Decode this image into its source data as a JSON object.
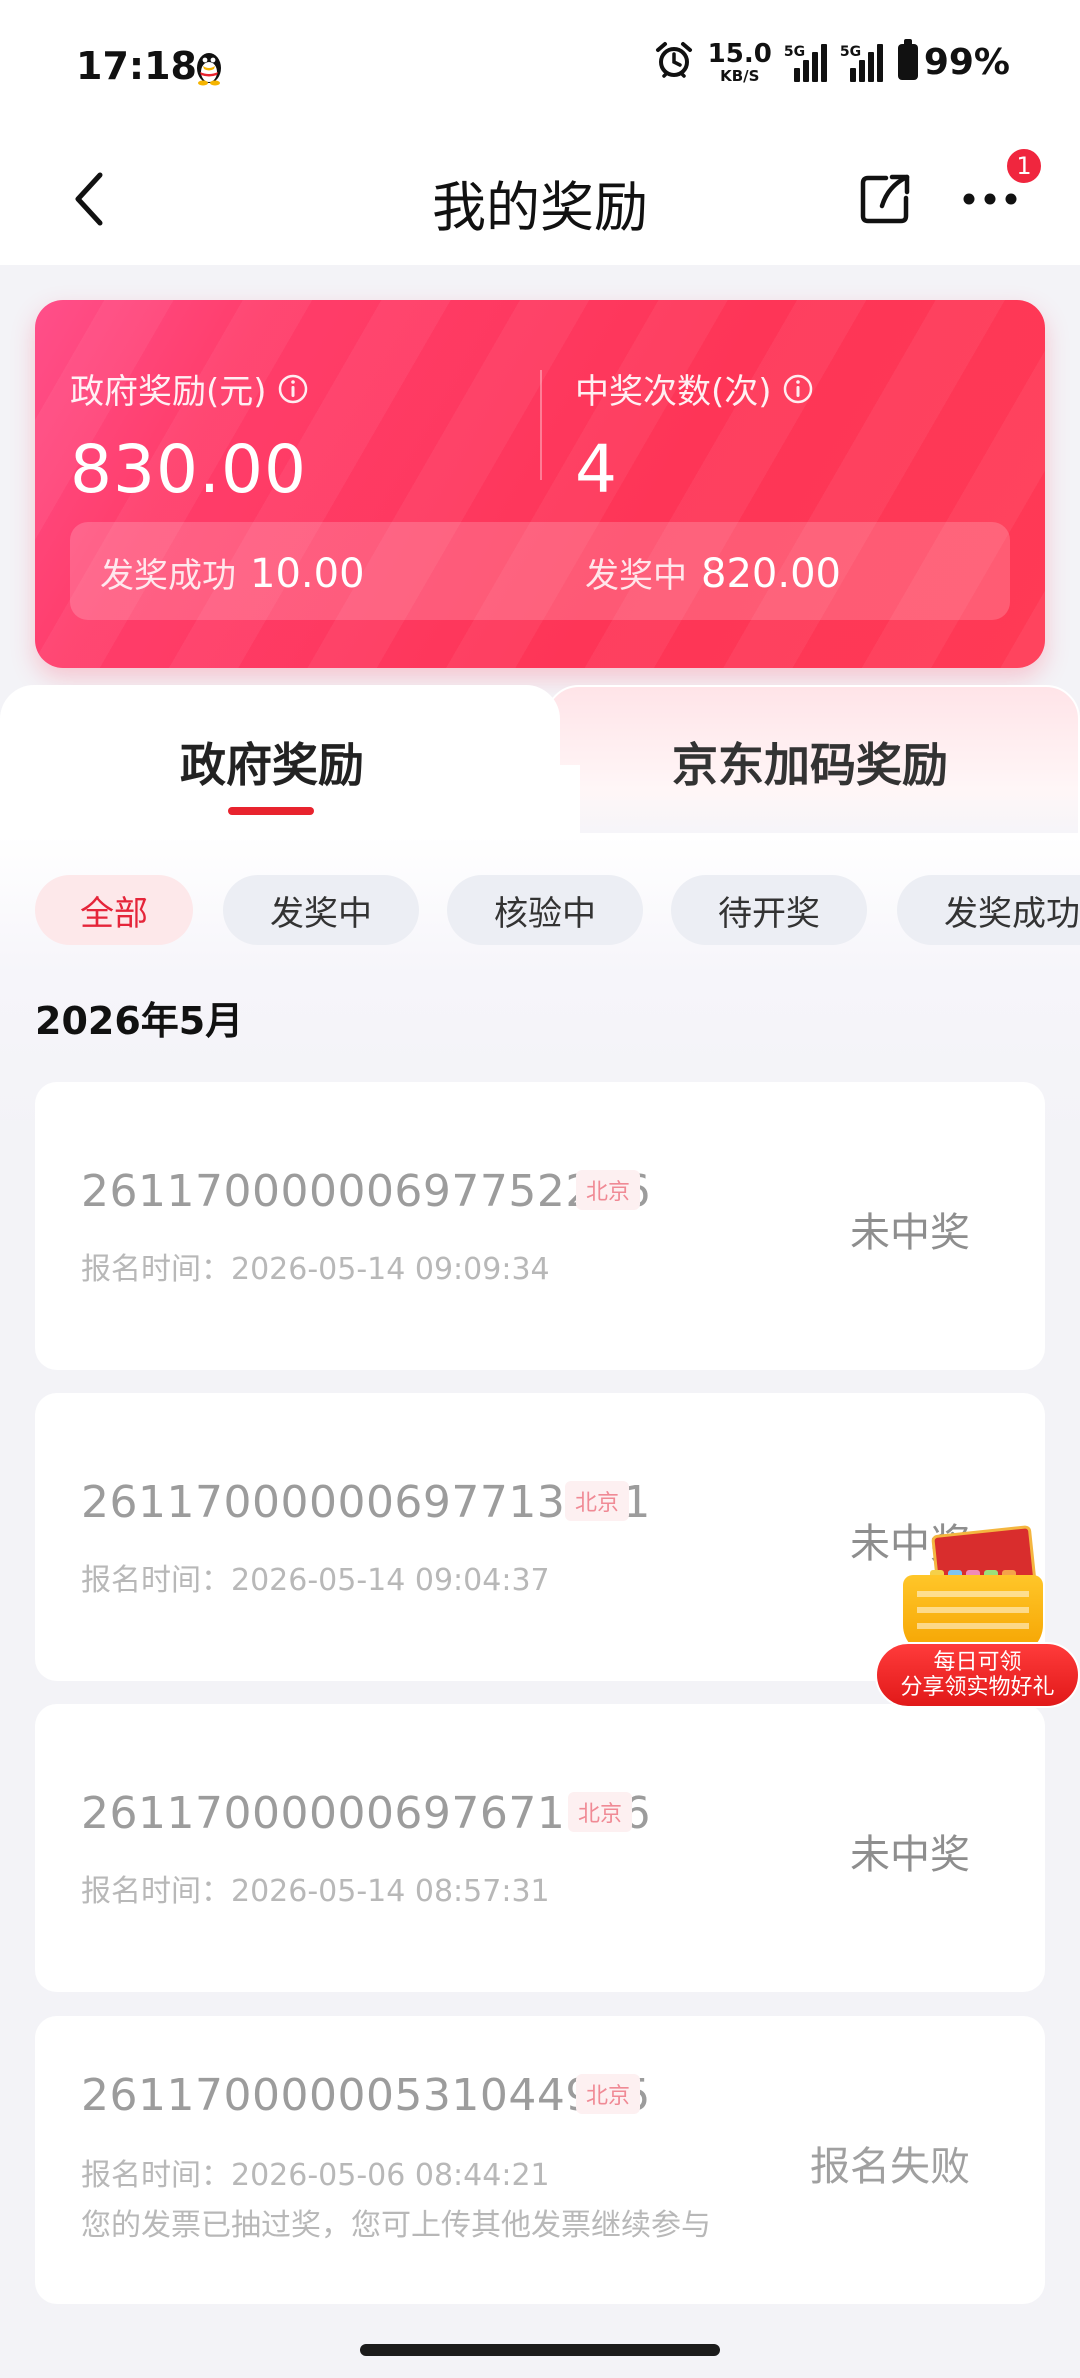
{
  "status_bar": {
    "time": "17:18",
    "net_speed_value": "15.0",
    "net_speed_unit": "KB/S",
    "signal1_label": "5G",
    "signal2_label": "5G",
    "battery": "99%"
  },
  "nav": {
    "title": "我的奖励",
    "more_badge": "1"
  },
  "summary": {
    "gov_reward_label": "政府奖励(元)",
    "gov_reward_value": "830.00",
    "win_count_label": "中奖次数(次)",
    "win_count_value": "4",
    "paid_label": "发奖成功",
    "paid_value": "10.00",
    "paying_label": "发奖中",
    "paying_value": "820.00"
  },
  "tabs": [
    {
      "label": "政府奖励",
      "active": true
    },
    {
      "label": "京东加码奖励",
      "active": false
    }
  ],
  "filters": [
    {
      "label": "全部",
      "active": true
    },
    {
      "label": "发奖中",
      "active": false
    },
    {
      "label": "核验中",
      "active": false
    },
    {
      "label": "待开奖",
      "active": false
    },
    {
      "label": "发奖成功",
      "active": false
    }
  ],
  "month": "2026年5月",
  "records": [
    {
      "id": "26117000000697752256",
      "region": "北京",
      "time": "报名时间：2026-05-14 09:09:34",
      "status": "未中奖",
      "note": ""
    },
    {
      "id": "26117000000697713321",
      "region": "北京",
      "time": "报名时间：2026-05-14 09:04:37",
      "status": "未中奖",
      "note": ""
    },
    {
      "id": "26117000000697671776",
      "region": "北京",
      "time": "报名时间：2026-05-14 08:57:31",
      "status": "未中奖",
      "note": ""
    },
    {
      "id": "26117000000531044905",
      "region": "北京",
      "time": "报名时间：2026-05-06 08:44:21",
      "status": "报名失败",
      "note": "您的发票已抽过奖，您可上传其他发票继续参与"
    }
  ],
  "promo": {
    "line1": "每日可领",
    "line2": "分享领实物好礼"
  },
  "colors": {
    "accent": "#e8232e",
    "card_gradient_start": "#ff4f8a",
    "card_gradient_end": "#fe3557",
    "badge": "#f0263e"
  }
}
